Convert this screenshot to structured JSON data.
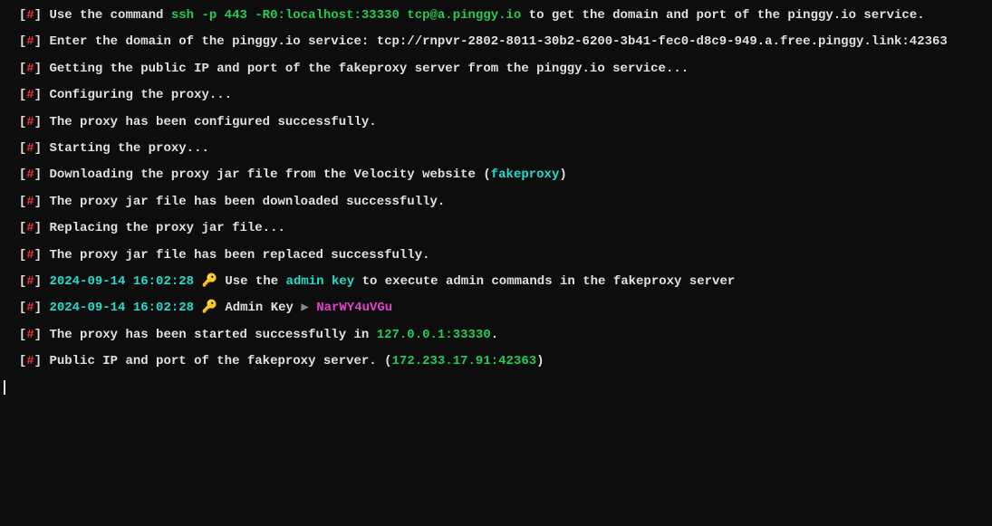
{
  "prefix": {
    "open": "[",
    "hash": "#",
    "close": "]"
  },
  "lines": {
    "l1_pre": "Use the command ",
    "l1_cmd": "ssh -p 443 -R0:localhost:33330 tcp@a.pinggy.io",
    "l1_post": " to get the domain and port of the pinggy.io service.",
    "l2_pre": "Enter the domain of the pinggy.io service: ",
    "l2_val": "tcp://rnpvr-2802-8011-30b2-6200-3b41-fec0-d8c9-949.a.free.pinggy.link:42363",
    "l3": "Getting the public IP and port of the fakeproxy server from the pinggy.io service...",
    "l4": "Configuring the proxy...",
    "l5": "The proxy has been configured successfully.",
    "l6": "Starting the proxy...",
    "l7_pre": "Downloading the proxy jar file from the Velocity website ",
    "l7_paren_open": "(",
    "l7_name": "fakeproxy",
    "l7_paren_close": ")",
    "l8": "The proxy jar file has been downloaded successfully.",
    "l9": "Replacing the proxy jar file...",
    "l10": "The proxy jar file has been replaced successfully.",
    "l11_ts": "2024-09-14 16:02:28",
    "l11_pre": " Use the ",
    "l11_key": "admin key",
    "l11_post": " to execute admin commands in the fakeproxy server",
    "l12_ts": "2024-09-14 16:02:28",
    "l12_label": " Admin Key ",
    "l12_arrow": "▶ ",
    "l12_val": "NarWY4uVGu",
    "l13_pre": "The proxy has been started successfully in ",
    "l13_addr": "127.0.0.1:33330",
    "l13_post": ".",
    "l14_pre": "Public IP and port of the fakeproxy server. ",
    "l14_paren_open": "(",
    "l14_addr": "172.233.17.91:42363",
    "l14_paren_close": ")",
    "key_icon": "🔑"
  }
}
